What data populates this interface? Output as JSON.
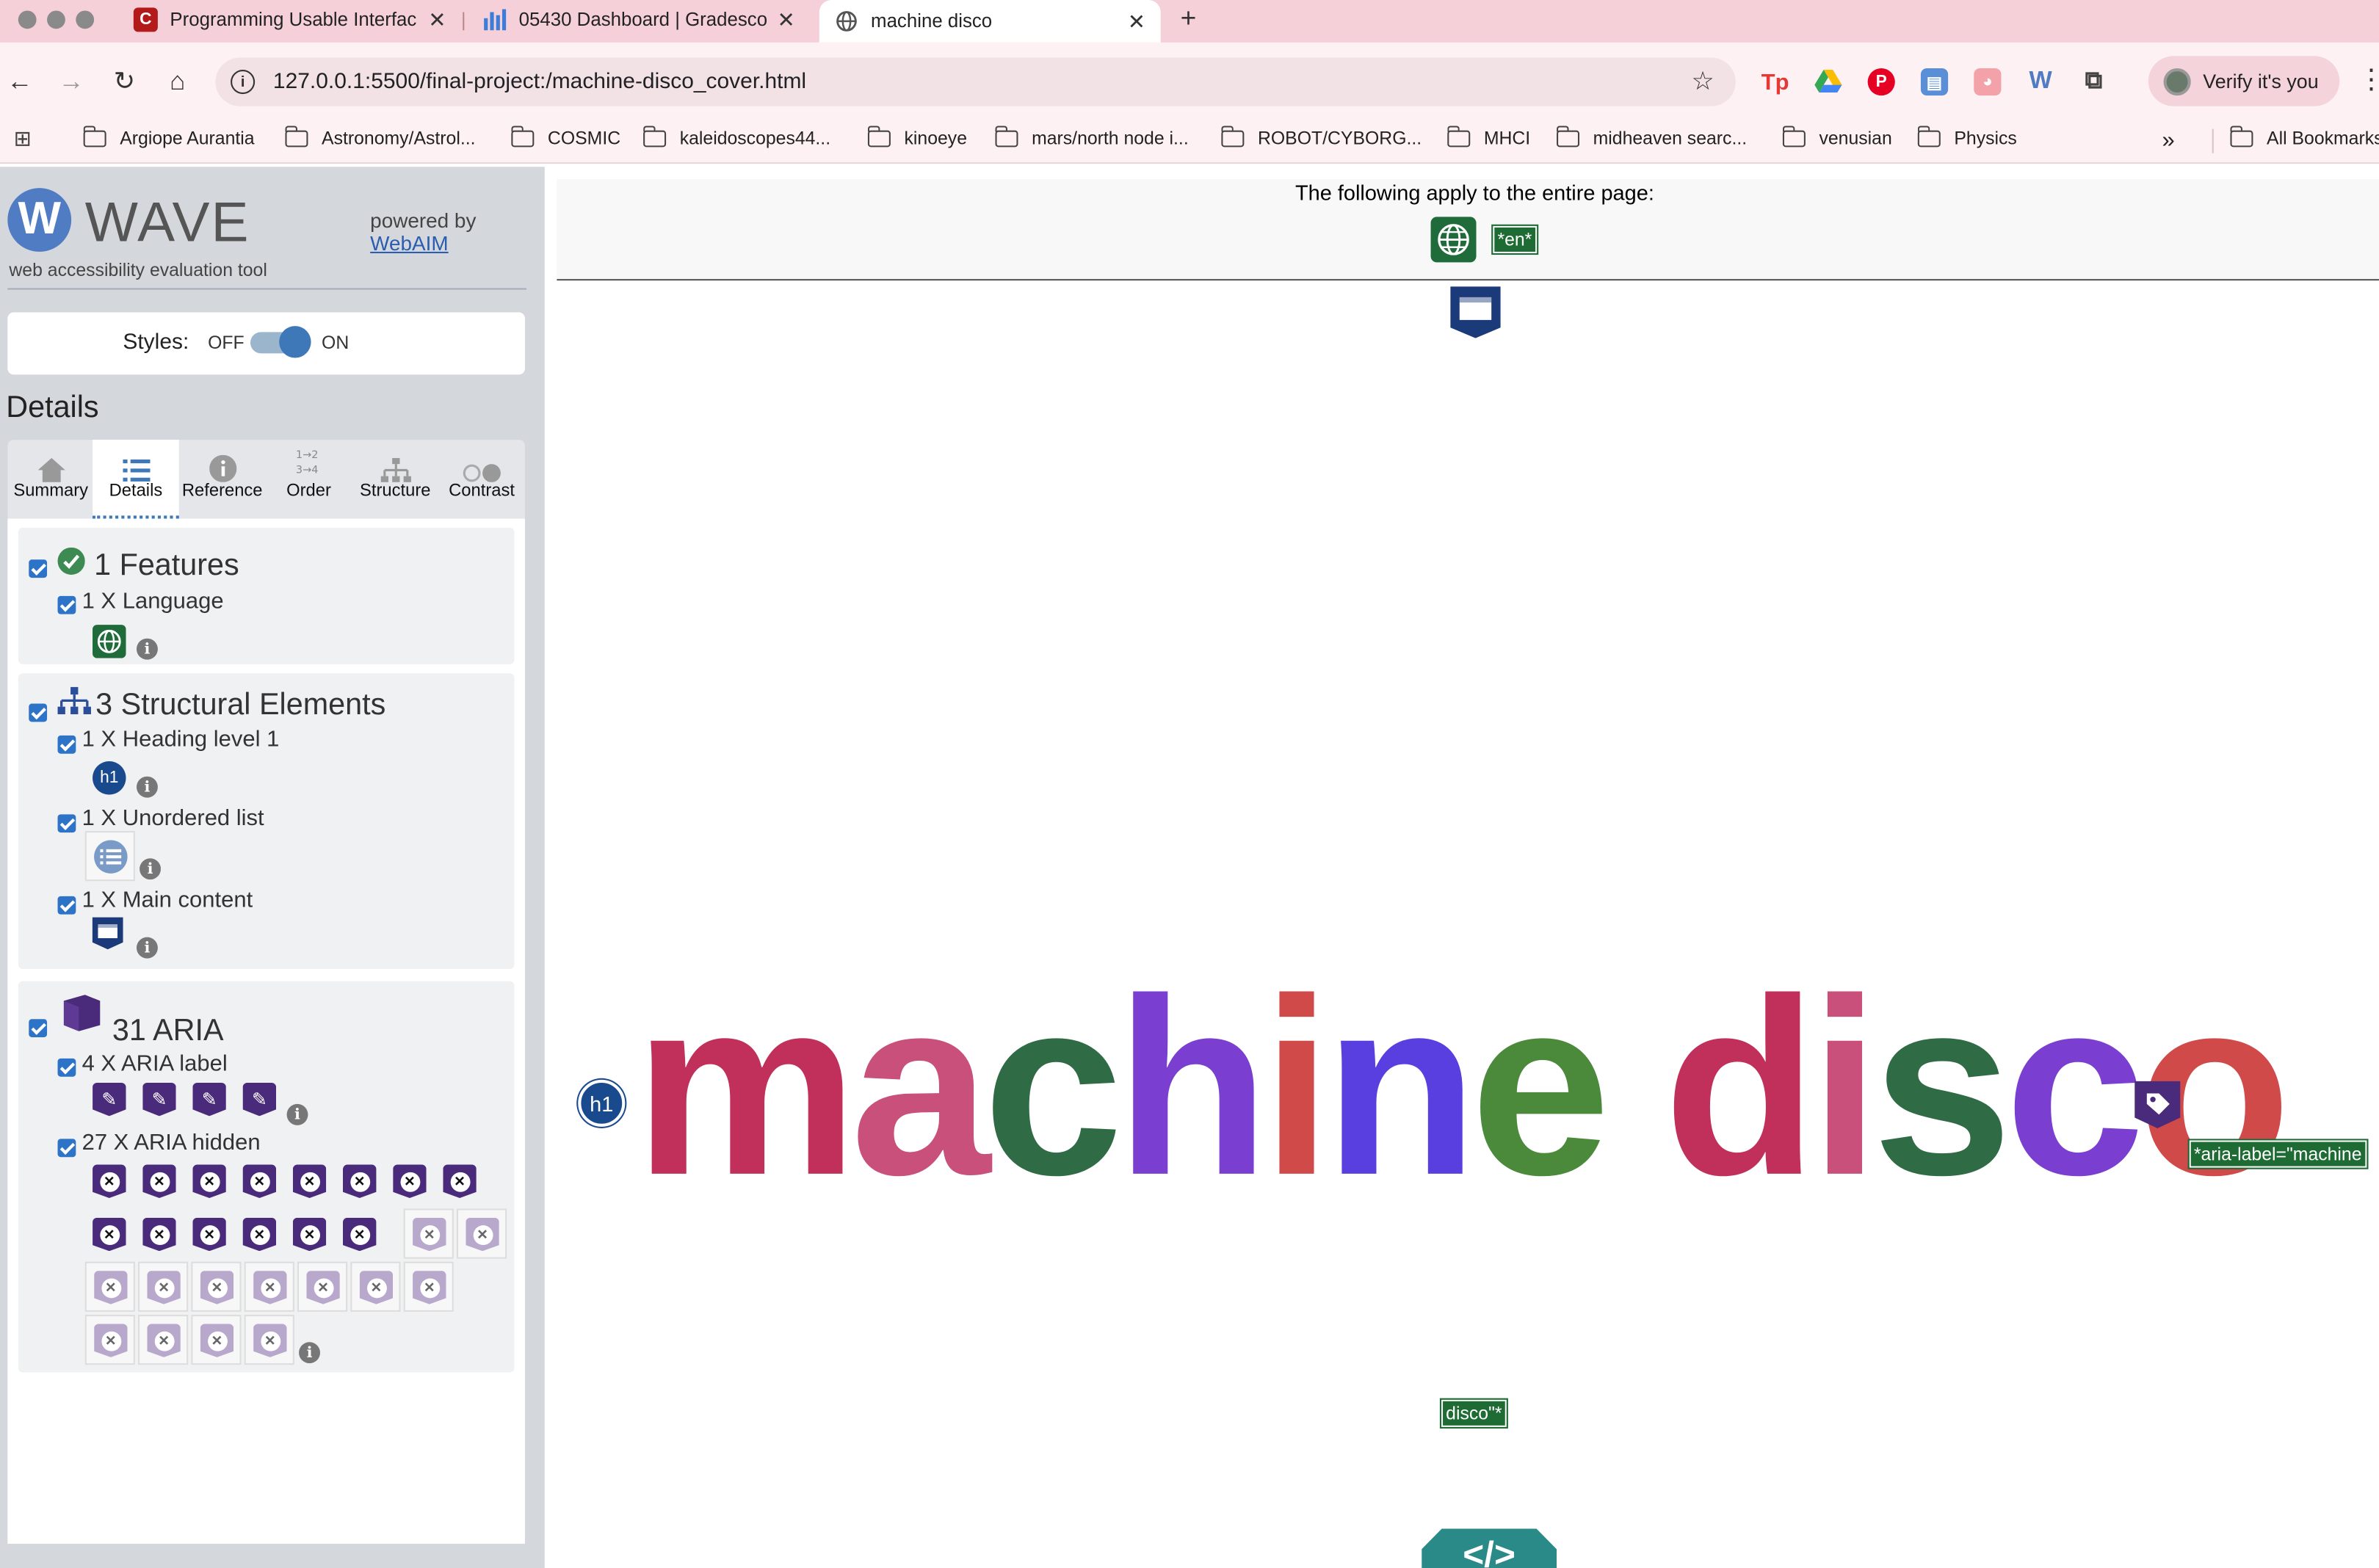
{
  "browser": {
    "tabs": [
      {
        "title": "Programming Usable Interfac",
        "favicon": "C",
        "color": "#b31b1b"
      },
      {
        "title": "05430 Dashboard | Gradesco",
        "favicon": "bar-chart",
        "color": "#3b7dd8"
      },
      {
        "title": "machine disco",
        "favicon": "globe",
        "color": "#555555"
      }
    ],
    "new_tab": "+",
    "url": "127.0.0.1:5500/final-project:/machine-disco_cover.html",
    "verify_label": "Verify it's you",
    "bookmarks": [
      "Argiope Aurantia",
      "Astronomy/Astrol...",
      "COSMIC",
      "kaleidoscopes44...",
      "kinoeye",
      "mars/north node i...",
      "ROBOT/CYBORG...",
      "MHCI",
      "midheaven searc...",
      "venusian",
      "Physics"
    ],
    "overflow": "»",
    "all_bookmarks": "All Bookmarks"
  },
  "wave": {
    "logo": "W",
    "title": "WAVE",
    "subtitle": "web accessibility evaluation tool",
    "powered_by": "powered by",
    "webaim": "WebAIM",
    "styles_label": "Styles:",
    "off": "OFF",
    "on": "ON",
    "details_heading": "Details",
    "tabs": [
      "Summary",
      "Details",
      "Reference",
      "Order",
      "Structure",
      "Contrast"
    ],
    "features": {
      "heading": "1 Features",
      "items": [
        "1 X Language"
      ]
    },
    "structural": {
      "heading": "3 Structural Elements",
      "items": [
        "1 X Heading level 1",
        "1 X Unordered list",
        "1 X Main content"
      ]
    },
    "aria": {
      "heading": "31 ARIA",
      "items": [
        "4 X ARIA label",
        "27 X ARIA hidden"
      ],
      "label_count": 4,
      "hidden_count": 27
    },
    "h1_icon": "h1"
  },
  "page": {
    "notice": "The following apply to the entire page:",
    "lang_label": "*en*",
    "title": "machine disco",
    "h1_badge": "h1",
    "aria_label_text": "*aria-label=\"machine",
    "aria_label_tail": "disco\"*",
    "code_badge": "</>",
    "title_letter_colors": [
      "#c0305a",
      "#c8507a",
      "#2f6b45",
      "#7a3fd0",
      "#d04a4a",
      "#5a3fe0",
      "#4a8a3a",
      "#c0305a",
      "#c8507a",
      "#2f6b45",
      "#7a3fd0",
      "#d04a4a"
    ]
  }
}
